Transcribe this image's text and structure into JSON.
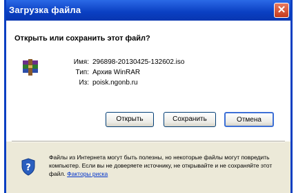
{
  "window": {
    "title": "Загрузка файла",
    "close_label": "✕"
  },
  "dialog": {
    "question": "Открыть или сохранить этот файл?",
    "file": {
      "name_label": "Имя:",
      "name": "296898-20130425-132602.iso",
      "type_label": "Тип:",
      "type": "Архив WinRAR",
      "from_label": "Из:",
      "from": "poisk.ngonb.ru"
    },
    "buttons": {
      "open": "Открыть",
      "save": "Сохранить",
      "cancel": "Отмена"
    },
    "warning": {
      "text": "Файлы из Интернета могут быть полезны, но некоторые файлы могут повредить компьютер. Если вы не доверяете источнику, не открывайте и не сохраняйте этот файл.",
      "link": "Факторы риска"
    }
  },
  "icons": {
    "file": "winrar-archive-icon",
    "warning": "shield-question-icon"
  },
  "colors": {
    "titlebar": "#0a3fc2",
    "close": "#c63a1c",
    "panel": "#ece9d8",
    "link": "#0033cc"
  }
}
